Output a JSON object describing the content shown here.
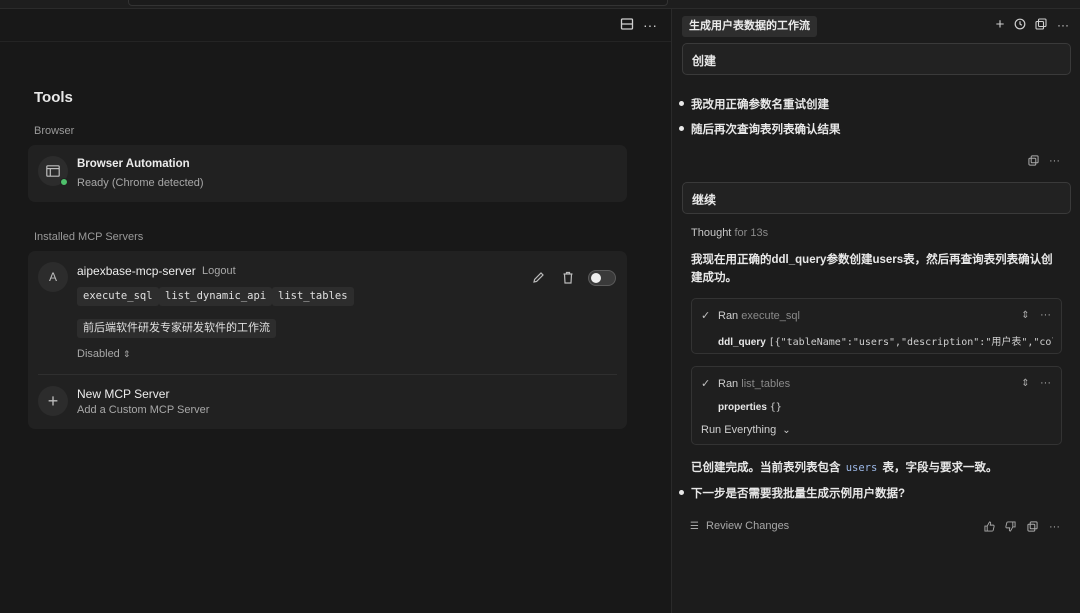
{
  "left": {
    "title": "Tools",
    "browser_section": "Browser",
    "browser_card": {
      "name": "Browser Automation",
      "status": "Ready (Chrome detected)",
      "status_color": "#4ec06b"
    },
    "mcp_section": "Installed MCP Servers",
    "server": {
      "avatar_letter": "A",
      "name": "aipexbase-mcp-server",
      "logout": "Logout",
      "tools": [
        "execute_sql",
        "list_dynamic_api",
        "list_tables"
      ],
      "prompt_chip": "前后端软件研发专家研发软件的工作流",
      "status_select": "Disabled"
    },
    "new_server": {
      "title": "New MCP Server",
      "subtitle": "Add a Custom MCP Server"
    }
  },
  "right": {
    "tab_title": "生成用户表数据的工作流",
    "msg1": "创建",
    "bullets1": [
      "我改用正确参数名重试创建",
      "随后再次查询表列表确认结果"
    ],
    "msg2": "继续",
    "thought_label": "Thought",
    "thought_time": "for 13s",
    "paragraph": "我现在用正确的ddl_query参数创建users表，然后再查询表列表确认创建成功。",
    "tool1": {
      "status": "Ran",
      "name": "execute_sql",
      "param_key": "ddl_query",
      "param_value": "[{\"tableName\":\"users\",\"description\":\"用户表\",\"colu…"
    },
    "tool2": {
      "status": "Ran",
      "name": "list_tables",
      "param_key": "properties",
      "param_value": "{}",
      "run_label": "Run Everything"
    },
    "result_prefix": "已创建完成。当前表列表包含",
    "result_code": "users",
    "result_suffix": "表，字段与要求一致。",
    "bullet_next": "下一步是否需要我批量生成示例用户数据?",
    "review": "Review Changes"
  }
}
